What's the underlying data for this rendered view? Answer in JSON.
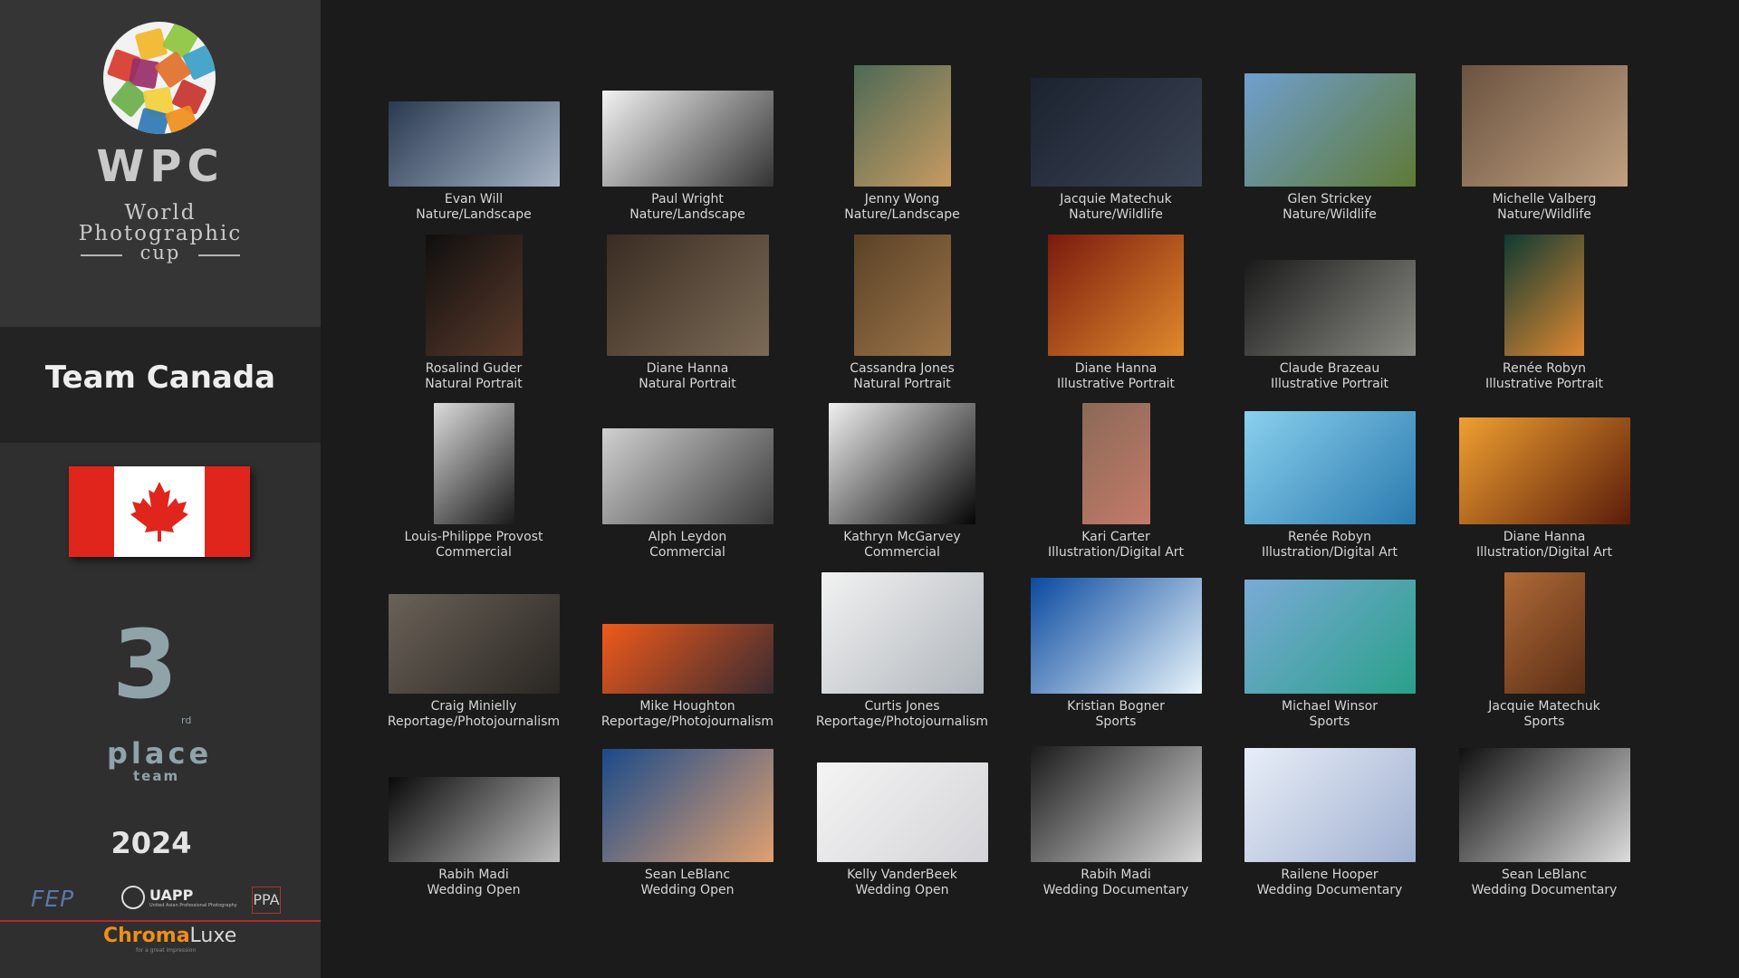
{
  "logo": {
    "title": "WPC",
    "line1": "World",
    "line2": "Photographic",
    "line3": "cup"
  },
  "team": "Team Canada",
  "rank": {
    "number": "3",
    "suffix": "rd",
    "place": "place",
    "team": "team"
  },
  "year": "2024",
  "sponsors": {
    "fep": "FEP",
    "uapp": "UAPP",
    "uapp_sub": "United Asian Professional Photography",
    "ppa": "PPA",
    "chroma_a": "Chroma",
    "chroma_b": "Luxe",
    "chroma_tag": "for a great impression"
  },
  "entries": [
    {
      "name": "Evan Will",
      "category": "Nature/Landscape",
      "colors": [
        "#2a3a52",
        "#a7b4c6"
      ]
    },
    {
      "name": "Paul Wright",
      "category": "Nature/Landscape",
      "colors": [
        "#f2f2f2",
        "#333333"
      ]
    },
    {
      "name": "Jenny Wong",
      "category": "Nature/Landscape",
      "colors": [
        "#4d6a55",
        "#c79a62"
      ]
    },
    {
      "name": "Jacquie Matechuk",
      "category": "Nature/Wildlife",
      "colors": [
        "#1b2230",
        "#3b4454"
      ]
    },
    {
      "name": "Glen Strickey",
      "category": "Nature/Wildlife",
      "colors": [
        "#6f9fcf",
        "#5f7a36"
      ]
    },
    {
      "name": "Michelle Valberg",
      "category": "Nature/Wildlife",
      "colors": [
        "#6b5340",
        "#c0a080"
      ]
    },
    {
      "name": "Rosalind Guder",
      "category": "Natural Portrait",
      "colors": [
        "#0f0f0f",
        "#5a3a2a"
      ]
    },
    {
      "name": "Diane Hanna",
      "category": "Natural Portrait",
      "colors": [
        "#3a2c22",
        "#7a6a56"
      ]
    },
    {
      "name": "Cassandra Jones",
      "category": "Natural Portrait",
      "colors": [
        "#5a4226",
        "#9c7448"
      ]
    },
    {
      "name": "Diane Hanna",
      "category": "Illustrative Portrait",
      "colors": [
        "#7a1a0e",
        "#e08a2c"
      ]
    },
    {
      "name": "Claude Brazeau",
      "category": "Illustrative Portrait",
      "colors": [
        "#1a1a1a",
        "#8a8a84"
      ]
    },
    {
      "name": "Renée Robyn",
      "category": "Illustrative Portrait",
      "colors": [
        "#0e3a34",
        "#e08830"
      ]
    },
    {
      "name": "Louis-Philippe Provost",
      "category": "Commercial",
      "colors": [
        "#dcdcdc",
        "#1a1a1a"
      ]
    },
    {
      "name": "Alph Leydon",
      "category": "Commercial",
      "colors": [
        "#d0d0d0",
        "#3a3a3a"
      ]
    },
    {
      "name": "Kathryn McGarvey",
      "category": "Commercial",
      "colors": [
        "#f0f0f0",
        "#050505"
      ]
    },
    {
      "name": "Kari Carter",
      "category": "Illustration/Digital Art",
      "colors": [
        "#8a6a56",
        "#c47a6a"
      ]
    },
    {
      "name": "Renée Robyn",
      "category": "Illustration/Digital Art",
      "colors": [
        "#8ad0ee",
        "#2a7aae"
      ]
    },
    {
      "name": "Diane Hanna",
      "category": "Illustration/Digital Art",
      "colors": [
        "#f0a030",
        "#5a1c0a"
      ]
    },
    {
      "name": "Craig Minielly",
      "category": "Reportage/Photojournalism",
      "colors": [
        "#6a6258",
        "#2a2622"
      ]
    },
    {
      "name": "Mike Houghton",
      "category": "Reportage/Photojournalism",
      "colors": [
        "#f05a1a",
        "#3a2a30"
      ]
    },
    {
      "name": "Curtis Jones",
      "category": "Reportage/Photojournalism",
      "colors": [
        "#f2f2f2",
        "#b0b6bc"
      ]
    },
    {
      "name": "Kristian Bogner",
      "category": "Sports",
      "colors": [
        "#0a4aa0",
        "#e8f4fa"
      ]
    },
    {
      "name": "Michael Winsor",
      "category": "Sports",
      "colors": [
        "#7aaad6",
        "#2aa08a"
      ]
    },
    {
      "name": "Jacquie Matechuk",
      "category": "Sports",
      "colors": [
        "#b06a36",
        "#5a2e16"
      ]
    },
    {
      "name": "Rabih Madi",
      "category": "Wedding Open",
      "colors": [
        "#0a0a0a",
        "#bdbdbd"
      ]
    },
    {
      "name": "Sean LeBlanc",
      "category": "Wedding Open",
      "colors": [
        "#1a4a8a",
        "#e0a070"
      ]
    },
    {
      "name": "Kelly VanderBeek",
      "category": "Wedding Open",
      "colors": [
        "#f4f4f4",
        "#d4d4d8"
      ]
    },
    {
      "name": "Rabih Madi",
      "category": "Wedding Documentary",
      "colors": [
        "#1a1a1a",
        "#d8d8d8"
      ]
    },
    {
      "name": "Railene Hooper",
      "category": "Wedding Documentary",
      "colors": [
        "#e8eef8",
        "#a0b0d0"
      ]
    },
    {
      "name": "Sean LeBlanc",
      "category": "Wedding Documentary",
      "colors": [
        "#101010",
        "#dcdcdc"
      ]
    }
  ]
}
